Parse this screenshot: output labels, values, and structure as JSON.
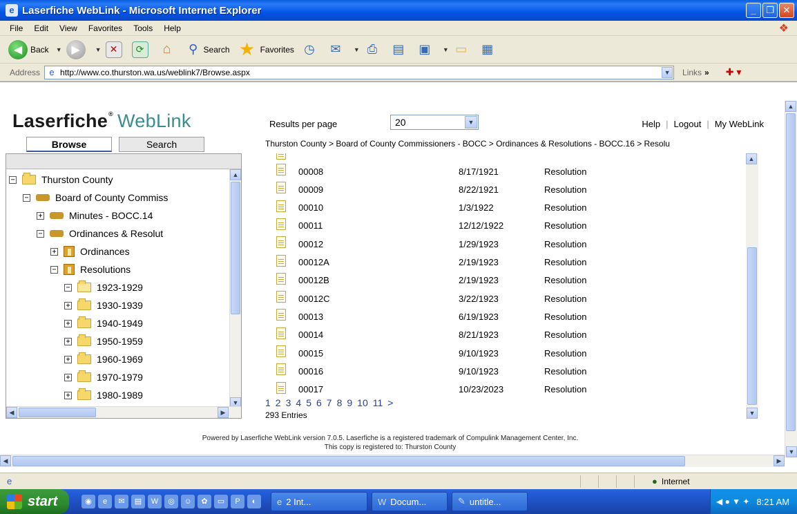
{
  "window": {
    "title": "Laserfiche WebLink - Microsoft Internet Explorer",
    "icon": "ie-icon"
  },
  "menu": [
    "File",
    "Edit",
    "View",
    "Favorites",
    "Tools",
    "Help"
  ],
  "toolbar": {
    "back_label": "Back",
    "search_label": "Search",
    "favorites_label": "Favorites"
  },
  "address": {
    "label": "Address",
    "url": "http://www.co.thurston.wa.us/weblink7/Browse.aspx",
    "links_label": "Links"
  },
  "app": {
    "logo_main": "Laserfiche",
    "logo_reg": "®",
    "logo_web": "WebLink",
    "tabs": {
      "browse": "Browse",
      "search": "Search"
    },
    "results_per_page_label": "Results per page",
    "results_per_page_value": "20",
    "links": {
      "help": "Help",
      "logout": "Logout",
      "my_weblink": "My WebLink"
    },
    "breadcrumb": "Thurston County > Board of County Commissioners - BOCC > Ordinances & Resolutions - BOCC.16 > Resolu"
  },
  "tree": [
    {
      "label": "Thurston County",
      "icon": "folder",
      "toggle": "⊟",
      "level": 0
    },
    {
      "label": "Board of County Commiss",
      "icon": "cabinet",
      "toggle": "⊟",
      "level": 1
    },
    {
      "label": "Minutes - BOCC.14",
      "icon": "cabinet",
      "toggle": "⊞",
      "level": 2
    },
    {
      "label": "Ordinances & Resolut",
      "icon": "cabinet",
      "toggle": "⊟",
      "level": 2
    },
    {
      "label": "Ordinances",
      "icon": "drawer",
      "toggle": "⊞",
      "level": 3
    },
    {
      "label": "Resolutions",
      "icon": "drawer",
      "toggle": "⊟",
      "level": 3
    },
    {
      "label": "1923-1929",
      "icon": "folder-open",
      "toggle": "⊟",
      "level": 4
    },
    {
      "label": "1930-1939",
      "icon": "folder",
      "toggle": "⊞",
      "level": 4
    },
    {
      "label": "1940-1949",
      "icon": "folder",
      "toggle": "⊞",
      "level": 4
    },
    {
      "label": "1950-1959",
      "icon": "folder",
      "toggle": "⊞",
      "level": 4
    },
    {
      "label": "1960-1969",
      "icon": "folder",
      "toggle": "⊞",
      "level": 4
    },
    {
      "label": "1970-1979",
      "icon": "folder",
      "toggle": "⊞",
      "level": 4
    },
    {
      "label": "1980-1989",
      "icon": "folder",
      "toggle": "⊞",
      "level": 4
    }
  ],
  "results": [
    {
      "name": "00008",
      "date": "8/17/1921",
      "type": "Resolution"
    },
    {
      "name": "00009",
      "date": "8/22/1921",
      "type": "Resolution"
    },
    {
      "name": "00010",
      "date": "1/3/1922",
      "type": "Resolution"
    },
    {
      "name": "00011",
      "date": "12/12/1922",
      "type": "Resolution"
    },
    {
      "name": "00012",
      "date": "1/29/1923",
      "type": "Resolution"
    },
    {
      "name": "00012A",
      "date": "2/19/1923",
      "type": "Resolution"
    },
    {
      "name": "00012B",
      "date": "2/19/1923",
      "type": "Resolution"
    },
    {
      "name": "00012C",
      "date": "3/22/1923",
      "type": "Resolution"
    },
    {
      "name": "00013",
      "date": "6/19/1923",
      "type": "Resolution"
    },
    {
      "name": "00014",
      "date": "8/21/1923",
      "type": "Resolution"
    },
    {
      "name": "00015",
      "date": "9/10/1923",
      "type": "Resolution"
    },
    {
      "name": "00016",
      "date": "9/10/1923",
      "type": "Resolution"
    },
    {
      "name": "00017",
      "date": "10/23/2023",
      "type": "Resolution"
    }
  ],
  "pager": {
    "pages": [
      "1",
      "2",
      "3",
      "4",
      "5",
      "6",
      "7",
      "8",
      "9",
      "10",
      "11",
      ">"
    ],
    "entries": "293 Entries"
  },
  "footer": {
    "line1": "Powered by Laserfiche WebLink version 7.0.5. Laserfiche is a registered trademark of Compulink Management Center, Inc.",
    "line2": "This copy is registered to: Thurston County"
  },
  "status": {
    "zone": "Internet"
  },
  "taskbar": {
    "start": "start",
    "tasks": [
      {
        "label": "2 Int...",
        "icon": "ie-icon"
      },
      {
        "label": "Docum...",
        "icon": "word-icon"
      },
      {
        "label": "untitle...",
        "icon": "paint-icon"
      }
    ],
    "clock": "8:21 AM"
  }
}
